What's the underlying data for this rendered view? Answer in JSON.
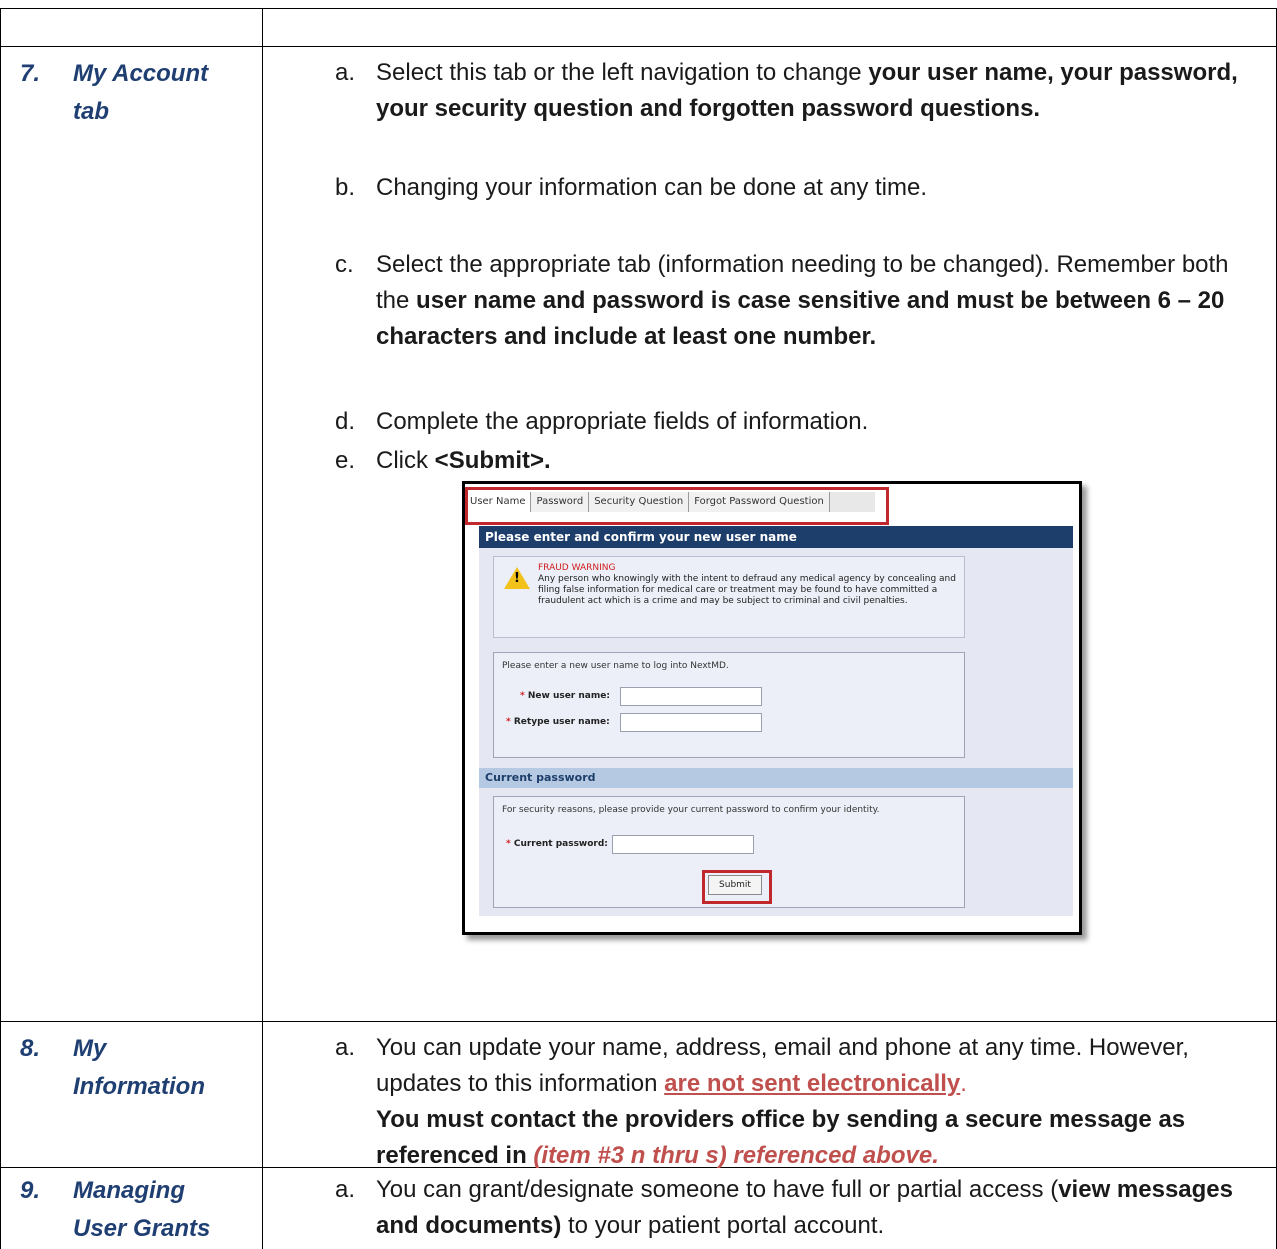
{
  "rows": [
    {
      "number": "7.",
      "title_lines": [
        "My Account",
        "tab"
      ],
      "items": [
        {
          "letter": "a.",
          "text_plain": "Select this tab or the left navigation to change ",
          "text_bold": "your user name, your password, your security question and forgotten password questions."
        },
        {
          "letter": "b.",
          "text_plain": "Changing your information can be done at any time."
        },
        {
          "letter": "c.",
          "text_plain": "Select the appropriate tab (information needing to be changed). Remember both the ",
          "text_bold": "user name and password is case sensitive and must be between 6 – 20 characters and include at least one number."
        },
        {
          "letter": "d.",
          "text_plain": "Complete the appropriate fields of information."
        },
        {
          "letter": "e.",
          "text_plain": "Click ",
          "text_bold": "<Submit>."
        }
      ]
    },
    {
      "number": "8.",
      "title_lines": [
        "My",
        "Information"
      ],
      "items": [
        {
          "letter": "a.",
          "text_plain": "You can update your name, address, email and phone at any time. However, updates to this information ",
          "text_red_underline": "are not sent electronically",
          "text_after": ".",
          "text_bold": "You must contact the providers office by sending a secure message as referenced in ",
          "text_red_italic": "(item #3 n thru s) referenced above."
        }
      ]
    },
    {
      "number": "9.",
      "title_lines": [
        "Managing",
        "User Grants"
      ],
      "items": [
        {
          "letter": "a.",
          "text_plain": "You can grant/designate someone to have full or partial access (",
          "text_bold": "view messages and documents)",
          "text_after": " to your patient portal account."
        }
      ]
    }
  ],
  "screenshot": {
    "tabs": [
      "User Name",
      "Password",
      "Security Question",
      "Forgot Password Question"
    ],
    "header": "Please enter and confirm your new user name",
    "warning_title": "FRAUD WARNING",
    "warning_text": "Any person who knowingly with the intent to defraud any medical agency by concealing and filing false information for medical care or treatment may be found to have committed a fraudulent act which is a crime and may be subject to criminal and civil penalties.",
    "username_note": "Please enter a new user name to log into NextMD.",
    "new_user_label": "New user name:",
    "retype_user_label": "Retype user name:",
    "password_header": "Current password",
    "password_note": "For security reasons, please provide your current password to confirm your identity.",
    "current_password_label": "Current password:",
    "submit_label": "Submit",
    "required_mark": "*"
  }
}
